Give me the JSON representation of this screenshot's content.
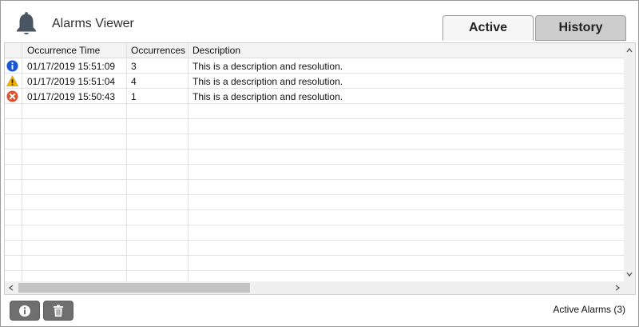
{
  "header": {
    "title": "Alarms Viewer",
    "icon": "bell-icon"
  },
  "tabs": [
    {
      "label": "Active",
      "selected": true
    },
    {
      "label": "History",
      "selected": false
    }
  ],
  "grid": {
    "columns": [
      "Occurrence Time",
      "Occurrences",
      "Description"
    ],
    "rows": [
      {
        "severity": "info",
        "icon": "info-icon",
        "time": "01/17/2019 15:51:09",
        "occurrences": "3",
        "description": "This is a description and resolution."
      },
      {
        "severity": "warning",
        "icon": "warning-icon",
        "time": "01/17/2019 15:51:04",
        "occurrences": "4",
        "description": "This is a description and resolution."
      },
      {
        "severity": "error",
        "icon": "error-icon",
        "time": "01/17/2019 15:50:43",
        "occurrences": "1",
        "description": "This is a description and resolution."
      }
    ]
  },
  "footer": {
    "status": "Active Alarms (3)"
  },
  "colors": {
    "info": "#1a55d6",
    "warning": "#f2b300",
    "error": "#e0522e",
    "button": "#6f6f6f",
    "tab_inactive": "#cdcdcd"
  }
}
